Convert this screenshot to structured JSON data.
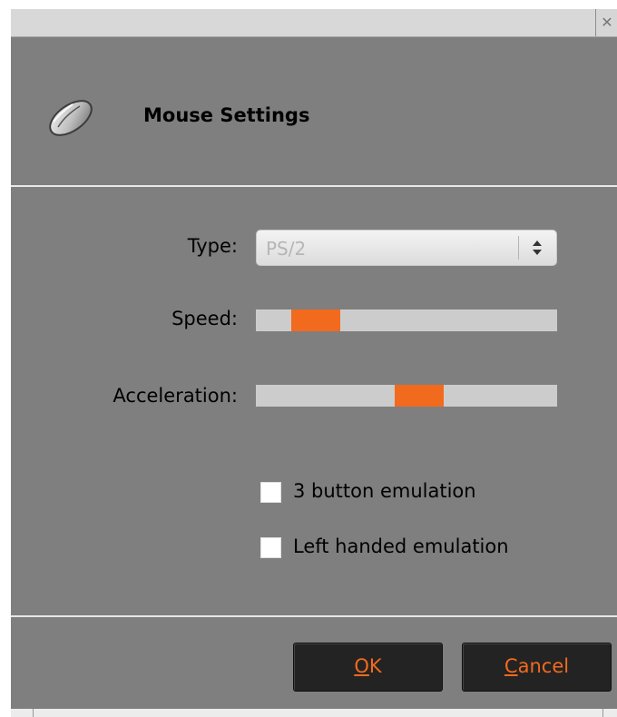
{
  "window": {
    "title": "",
    "close_glyph": "✕",
    "close_icon": "close-icon"
  },
  "header": {
    "title": "Mouse Settings",
    "icon": "mouse-icon"
  },
  "form": {
    "type_label": "Type:",
    "type_value": "PS/2",
    "speed_label": "Speed:",
    "speed_level": 0.14,
    "acceleration_label": "Acceleration:",
    "acceleration_level": 0.55,
    "options": [
      {
        "label": "3 button emulation",
        "checked": false
      },
      {
        "label": "Left handed emulation",
        "checked": false
      }
    ]
  },
  "buttons": {
    "ok_mnemonic": "O",
    "ok_rest": "K",
    "cancel_mnemonic": "C",
    "cancel_rest": "ancel"
  },
  "colors": {
    "accent": "#f26a1e",
    "dialog_bg": "#7f7f7f",
    "button_bg": "#232323"
  }
}
